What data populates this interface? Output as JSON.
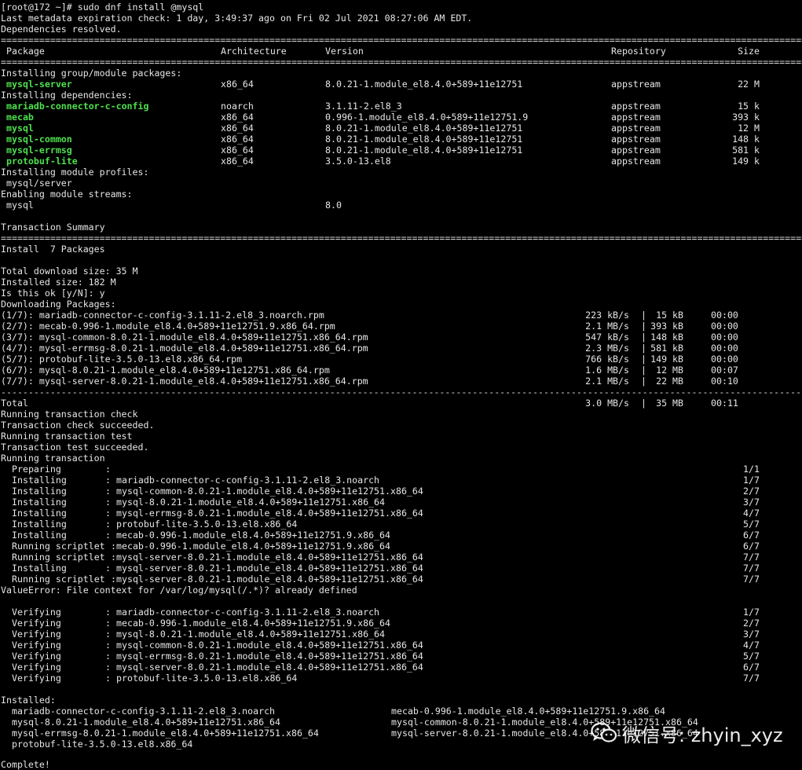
{
  "colors": {
    "background": "#000000",
    "text": "#e6e6e6",
    "package_highlight": "#4ee04e"
  },
  "command": "[root@172 ~]# sudo dnf install @mysql",
  "meta": {
    "expiration": "Last metadata expiration check: 1 day, 3:49:37 ago on Fri 02 Jul 2021 08:27:06 AM EDT.",
    "resolved": "Dependencies resolved."
  },
  "separator_double": "================================================================================================================================================================",
  "separator_dash": "----------------------------------------------------------------------------------------------------------------------------------------------------------------",
  "table": {
    "headers": {
      "package": "Package",
      "arch": "Architecture",
      "version": "Version",
      "repo": "Repository",
      "size": "Size"
    },
    "group_label": "Installing group/module packages:",
    "group_rows": [
      {
        "package": "mysql-server",
        "arch": "x86_64",
        "version": "8.0.21-1.module_el8.4.0+589+11e12751",
        "repo": "appstream",
        "size": "22 M"
      }
    ],
    "deps_label": "Installing dependencies:",
    "dep_rows": [
      {
        "package": "mariadb-connector-c-config",
        "arch": "noarch",
        "version": "3.1.11-2.el8_3",
        "repo": "appstream",
        "size": "15 k"
      },
      {
        "package": "mecab",
        "arch": "x86_64",
        "version": "0.996-1.module_el8.4.0+589+11e12751.9",
        "repo": "appstream",
        "size": "393 k"
      },
      {
        "package": "mysql",
        "arch": "x86_64",
        "version": "8.0.21-1.module_el8.4.0+589+11e12751",
        "repo": "appstream",
        "size": "12 M"
      },
      {
        "package": "mysql-common",
        "arch": "x86_64",
        "version": "8.0.21-1.module_el8.4.0+589+11e12751",
        "repo": "appstream",
        "size": "148 k"
      },
      {
        "package": "mysql-errmsg",
        "arch": "x86_64",
        "version": "8.0.21-1.module_el8.4.0+589+11e12751",
        "repo": "appstream",
        "size": "581 k"
      },
      {
        "package": "protobuf-lite",
        "arch": "x86_64",
        "version": "3.5.0-13.el8",
        "repo": "appstream",
        "size": "149 k"
      }
    ],
    "profiles_label": "Installing module profiles:",
    "profile": "mysql/server",
    "streams_label": "Enabling module streams:",
    "stream_name": "mysql",
    "stream_version": "8.0"
  },
  "summary": {
    "title": "Transaction Summary",
    "install": "Install  7 Packages",
    "download_size": "Total download size: 35 M",
    "installed_size": "Installed size: 182 M",
    "prompt": "Is this ok [y/N]: y",
    "downloading": "Downloading Packages:"
  },
  "downloads": [
    {
      "file": "(1/7): mariadb-connector-c-config-3.1.11-2.el8_3.noarch.rpm",
      "rate": "223 kB/s",
      "size": "15 kB",
      "time": "00:00"
    },
    {
      "file": "(2/7): mecab-0.996-1.module_el8.4.0+589+11e12751.9.x86_64.rpm",
      "rate": "2.1 MB/s",
      "size": "393 kB",
      "time": "00:00"
    },
    {
      "file": "(3/7): mysql-common-8.0.21-1.module_el8.4.0+589+11e12751.x86_64.rpm",
      "rate": "547 kB/s",
      "size": "148 kB",
      "time": "00:00"
    },
    {
      "file": "(4/7): mysql-errmsg-8.0.21-1.module_el8.4.0+589+11e12751.x86_64.rpm",
      "rate": "2.3 MB/s",
      "size": "581 kB",
      "time": "00:00"
    },
    {
      "file": "(5/7): protobuf-lite-3.5.0-13.el8.x86_64.rpm",
      "rate": "766 kB/s",
      "size": "149 kB",
      "time": "00:00"
    },
    {
      "file": "(6/7): mysql-8.0.21-1.module_el8.4.0+589+11e12751.x86_64.rpm",
      "rate": "1.6 MB/s",
      "size": "12 MB",
      "time": "00:07"
    },
    {
      "file": "(7/7): mysql-server-8.0.21-1.module_el8.4.0+589+11e12751.x86_64.rpm",
      "rate": "2.1 MB/s",
      "size": "22 MB",
      "time": "00:10"
    }
  ],
  "total": {
    "label": "Total",
    "rate": "3.0 MB/s",
    "size": "35 MB",
    "time": "00:11"
  },
  "pipe": "|",
  "transaction": {
    "lines": [
      "Running transaction check",
      "Transaction check succeeded.",
      "Running transaction test",
      "Transaction test succeeded.",
      "Running transaction"
    ],
    "steps": [
      {
        "action": "Preparing",
        "pkg": "",
        "count": "1/1"
      },
      {
        "action": "Installing",
        "pkg": "mariadb-connector-c-config-3.1.11-2.el8_3.noarch",
        "count": "1/7"
      },
      {
        "action": "Installing",
        "pkg": "mysql-common-8.0.21-1.module_el8.4.0+589+11e12751.x86_64",
        "count": "2/7"
      },
      {
        "action": "Installing",
        "pkg": "mysql-8.0.21-1.module_el8.4.0+589+11e12751.x86_64",
        "count": "3/7"
      },
      {
        "action": "Installing",
        "pkg": "mysql-errmsg-8.0.21-1.module_el8.4.0+589+11e12751.x86_64",
        "count": "4/7"
      },
      {
        "action": "Installing",
        "pkg": "protobuf-lite-3.5.0-13.el8.x86_64",
        "count": "5/7"
      },
      {
        "action": "Installing",
        "pkg": "mecab-0.996-1.module_el8.4.0+589+11e12751.9.x86_64",
        "count": "6/7"
      },
      {
        "action": "Running scriptlet",
        "pkg": "mecab-0.996-1.module_el8.4.0+589+11e12751.9.x86_64",
        "count": "6/7"
      },
      {
        "action": "Running scriptlet",
        "pkg": "mysql-server-8.0.21-1.module_el8.4.0+589+11e12751.x86_64",
        "count": "7/7"
      },
      {
        "action": "Installing",
        "pkg": "mysql-server-8.0.21-1.module_el8.4.0+589+11e12751.x86_64",
        "count": "7/7"
      },
      {
        "action": "Running scriptlet",
        "pkg": "mysql-server-8.0.21-1.module_el8.4.0+589+11e12751.x86_64",
        "count": "7/7"
      }
    ],
    "error": "ValueError: File context for /var/log/mysql(/.*)? already defined",
    "verify": [
      {
        "action": "Verifying",
        "pkg": "mariadb-connector-c-config-3.1.11-2.el8_3.noarch",
        "count": "1/7"
      },
      {
        "action": "Verifying",
        "pkg": "mecab-0.996-1.module_el8.4.0+589+11e12751.9.x86_64",
        "count": "2/7"
      },
      {
        "action": "Verifying",
        "pkg": "mysql-8.0.21-1.module_el8.4.0+589+11e12751.x86_64",
        "count": "3/7"
      },
      {
        "action": "Verifying",
        "pkg": "mysql-common-8.0.21-1.module_el8.4.0+589+11e12751.x86_64",
        "count": "4/7"
      },
      {
        "action": "Verifying",
        "pkg": "mysql-errmsg-8.0.21-1.module_el8.4.0+589+11e12751.x86_64",
        "count": "5/7"
      },
      {
        "action": "Verifying",
        "pkg": "mysql-server-8.0.21-1.module_el8.4.0+589+11e12751.x86_64",
        "count": "6/7"
      },
      {
        "action": "Verifying",
        "pkg": "protobuf-lite-3.5.0-13.el8.x86_64",
        "count": "7/7"
      }
    ]
  },
  "installed": {
    "label": "Installed:",
    "pairs": [
      [
        "mariadb-connector-c-config-3.1.11-2.el8_3.noarch",
        "mecab-0.996-1.module_el8.4.0+589+11e12751.9.x86_64"
      ],
      [
        "mysql-8.0.21-1.module_el8.4.0+589+11e12751.x86_64",
        "mysql-common-8.0.21-1.module_el8.4.0+589+11e12751.x86_64"
      ],
      [
        "mysql-errmsg-8.0.21-1.module_el8.4.0+589+11e12751.x86_64",
        "mysql-server-8.0.21-1.module_el8.4.0+589+11e12751.x86_64"
      ],
      [
        "protobuf-lite-3.5.0-13.el8.x86_64",
        ""
      ]
    ],
    "complete": "Complete!"
  },
  "watermark": {
    "text": "微信号: zhyin_xyz",
    "icon": "wechat-icon"
  }
}
